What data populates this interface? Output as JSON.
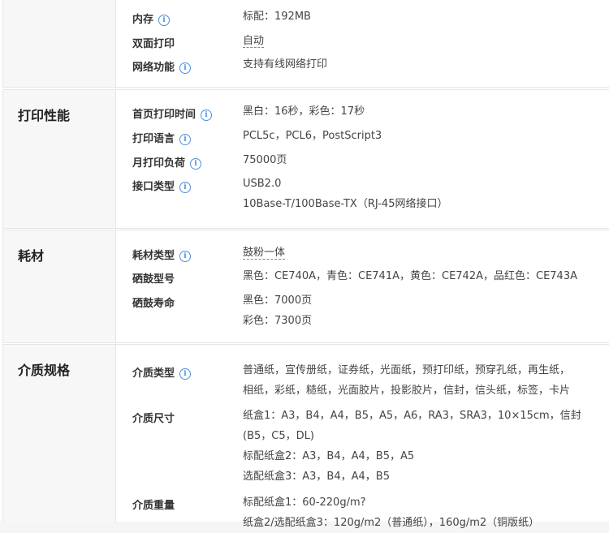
{
  "sections": [
    {
      "category": "",
      "rows": [
        {
          "label": "内存",
          "has_info": true,
          "lines": [
            "标配：192MB"
          ]
        },
        {
          "label": "双面打印",
          "has_info": false,
          "lines": [
            "自动"
          ]
        },
        {
          "label": "网络功能",
          "has_info": true,
          "lines": [
            "支持有线网络打印"
          ]
        }
      ]
    },
    {
      "category": "打印性能",
      "rows": [
        {
          "label": "首页打印时间",
          "has_info": true,
          "lines": [
            "黑白：16秒，彩色：17秒"
          ]
        },
        {
          "label": "打印语言",
          "has_info": true,
          "lines": [
            "PCL5c，PCL6，PostScript3"
          ]
        },
        {
          "label": "月打印负荷",
          "has_info": true,
          "lines": [
            "75000页"
          ]
        },
        {
          "label": "接口类型",
          "has_info": true,
          "lines": [
            "USB2.0",
            "10Base-T/100Base-TX（RJ-45网络接口）"
          ]
        }
      ]
    },
    {
      "category": "耗材",
      "rows": [
        {
          "label": "耗材类型",
          "has_info": true,
          "lines": [
            "鼓粉一体"
          ]
        },
        {
          "label": "硒鼓型号",
          "has_info": false,
          "lines": [
            "黑色：CE740A，青色：CE741A，黄色：CE742A，品红色：CE743A"
          ]
        },
        {
          "label": "硒鼓寿命",
          "has_info": false,
          "lines": [
            "黑色：7000页",
            "彩色：7300页"
          ]
        }
      ]
    },
    {
      "category": "介质规格",
      "rows": [
        {
          "label": "介质类型",
          "has_info": true,
          "lines": [
            "普通纸，宣传册纸，证券纸，光面纸，预打印纸，预穿孔纸，再生纸，",
            "相纸，彩纸，糙纸，光面胶片，投影胶片，信封，信头纸，标签，卡片"
          ]
        },
        {
          "label": "介质尺寸",
          "has_info": false,
          "lines": [
            "纸盒1：A3，B4，A4，B5，A5，A6，RA3，SRA3，10×15cm，信封",
            "(B5，C5，DL)",
            "标配纸盒2：A3，B4，A4，B5，A5",
            "选配纸盒3：A3，B4，A4，B5"
          ]
        },
        {
          "label": "介质重量",
          "has_info": false,
          "lines": [
            "标配纸盒1：60-220g/m?",
            "纸盒2/选配纸盒3：120g/m2（普通纸），160g/m2（铜版纸）"
          ]
        }
      ]
    }
  ]
}
